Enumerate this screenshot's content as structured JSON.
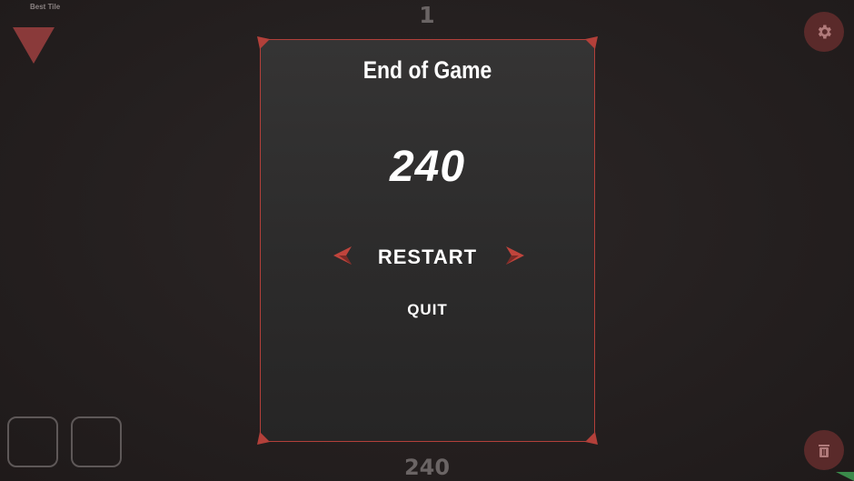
{
  "hud": {
    "best_tile_label": "Best Tile",
    "level": "1",
    "bottom_score": "240"
  },
  "modal": {
    "title": "End of Game",
    "score": "240",
    "restart_label": "RESTART",
    "quit_label": "QUIT"
  },
  "icons": {
    "settings": "gear-icon",
    "trash": "trash-icon",
    "best_tile": "triangle-down-icon"
  },
  "colors": {
    "accent_red": "#b3403a",
    "button_bg": "#5a2a2a",
    "triangle": "#8a3a3a"
  }
}
